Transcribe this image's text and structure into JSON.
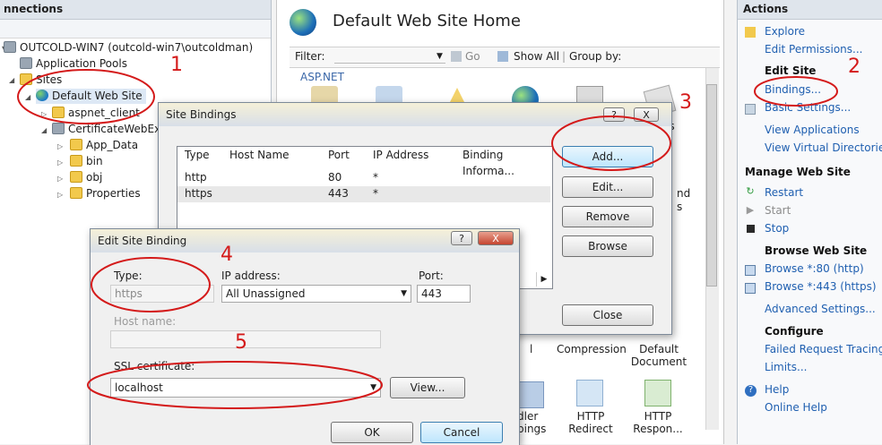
{
  "connections": {
    "header": "nnections",
    "tree": {
      "server": "OUTCOLD-WIN7 (outcold-win7\\outcoldman)",
      "app_pools": "Application Pools",
      "sites": "Sites",
      "default_site": "Default Web Site",
      "aspnet_client": "aspnet_client",
      "cert_example": "CertificateWebExam",
      "app_data": "App_Data",
      "bin": "bin",
      "obj": "obj",
      "properties": "Properties"
    }
  },
  "center": {
    "title": "Default Web Site Home",
    "filter_label": "Filter:",
    "go_label": "Go",
    "show_all_label": "Show All",
    "group_by_label": "Group by:",
    "group_name": "ASP.NET",
    "features": {
      "compression": "Compression",
      "default_document": "Default Document",
      "handler_mappings_partial": "dler pings",
      "http_redirect": "HTTP Redirect",
      "http_response": "HTTP Respon...",
      "partial_es": "es",
      "partial_nd": "nd",
      "partial_s": "s",
      "partial_l": "l"
    }
  },
  "actions": {
    "header": "Actions",
    "explore": "Explore",
    "edit_permissions": "Edit Permissions...",
    "edit_site_header": "Edit Site",
    "bindings": "Bindings...",
    "basic_settings": "Basic Settings...",
    "view_applications": "View Applications",
    "view_virtual_dirs": "View Virtual Directories",
    "manage_header": "Manage Web Site",
    "restart": "Restart",
    "start": "Start",
    "stop": "Stop",
    "browse_header": "Browse Web Site",
    "browse_80": "Browse *:80 (http)",
    "browse_443": "Browse *:443 (https)",
    "advanced_settings": "Advanced Settings...",
    "configure_header": "Configure",
    "failed_request": "Failed Request Tracing...",
    "limits": "Limits...",
    "help": "Help",
    "online_help": "Online Help"
  },
  "site_bindings": {
    "title": "Site Bindings",
    "help_btn": "?",
    "close_btn": "X",
    "columns": [
      "Type",
      "Host Name",
      "Port",
      "IP Address",
      "Binding Informa..."
    ],
    "rows": [
      {
        "type": "http",
        "host": "",
        "port": "80",
        "ip": "*",
        "info": ""
      },
      {
        "type": "https",
        "host": "",
        "port": "443",
        "ip": "*",
        "info": ""
      }
    ],
    "add": "Add...",
    "edit": "Edit...",
    "remove": "Remove",
    "browse": "Browse",
    "close": "Close"
  },
  "edit_binding": {
    "title": "Edit Site Binding",
    "help_btn": "?",
    "close_btn": "X",
    "type_label": "Type:",
    "type_value": "https",
    "ip_label": "IP address:",
    "ip_value": "All Unassigned",
    "port_label": "Port:",
    "port_value": "443",
    "host_label": "Host name:",
    "host_value": "",
    "ssl_label": "SSL certificate:",
    "ssl_value": "localhost",
    "view": "View...",
    "ok": "OK",
    "cancel": "Cancel"
  },
  "annotations": {
    "n1": "1",
    "n2": "2",
    "n3": "3",
    "n4": "4",
    "n5": "5"
  },
  "colors": {
    "annotation": "#d41a1a",
    "link": "#1f5fb0"
  }
}
